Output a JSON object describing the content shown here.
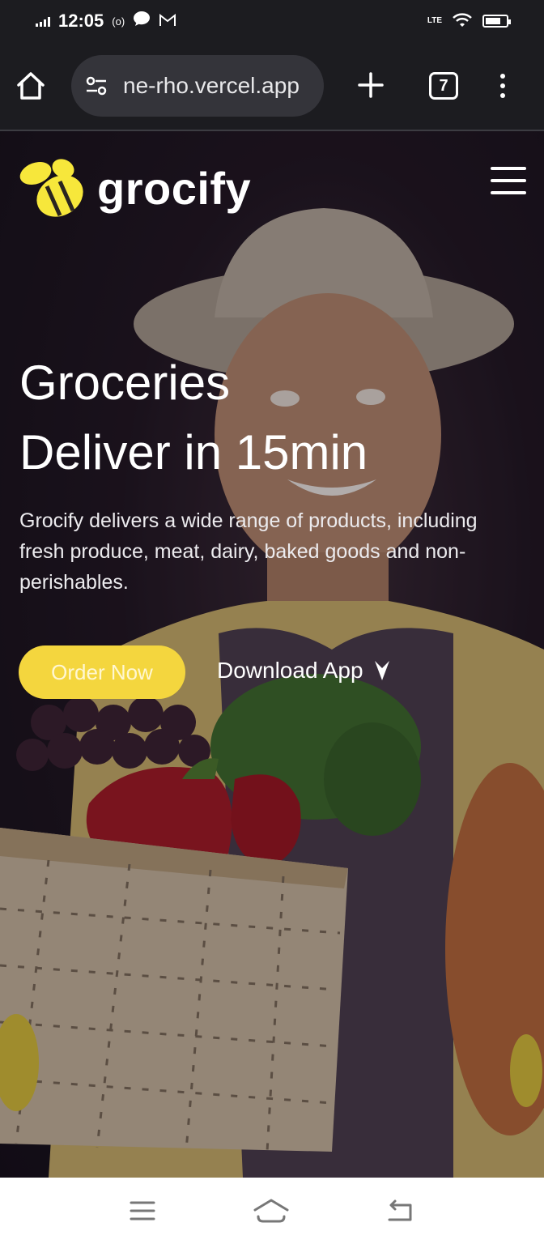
{
  "status_bar": {
    "time": "12:05",
    "notif_icons": [
      "radio-icon",
      "chat-bubble-icon",
      "gmail-icon"
    ],
    "network_label": "LTE",
    "battery_icon": "battery-icon"
  },
  "browser": {
    "url": "ne-rho.vercel.app",
    "tab_count": "7",
    "icons": [
      "home-icon",
      "tune-icon",
      "plus-icon",
      "tabs-icon",
      "more-vert-icon"
    ]
  },
  "site": {
    "brand": "grocify",
    "headline_line1": "Groceries",
    "headline_line2": "Deliver in 15min",
    "description": "Grocify delivers a wide range of products, including fresh produce, meat, dairy, baked goods and non-perishables.",
    "order_label": "Order Now",
    "download_label": "Download App",
    "colors": {
      "accent": "#f4d63e",
      "logo": "#f7e73b",
      "background": "#1a1420"
    }
  },
  "system_nav": {
    "icons": [
      "recents-icon",
      "home-icon",
      "back-icon"
    ]
  }
}
